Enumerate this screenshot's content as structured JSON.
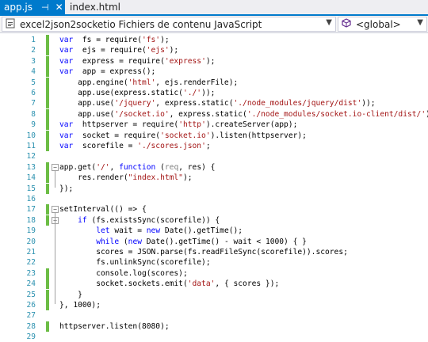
{
  "tabs": [
    {
      "label": "app.js",
      "active": true,
      "pin": "⊣",
      "close": "✕"
    },
    {
      "label": "index.html",
      "active": false
    }
  ],
  "nav": {
    "project_label": "excel2json2socketio Fichiers de contenu JavaScript",
    "scope_label": "<global>"
  },
  "colors": {
    "accent": "#007acc",
    "line_numbers": "#2b91af",
    "change_bar": "#6cbd45",
    "keyword": "#0000ff",
    "string": "#a31515"
  },
  "lines": [
    {
      "n": "1",
      "changed": true,
      "code": [
        [
          "kw",
          "var"
        ],
        [
          "",
          "  fs = require("
        ],
        [
          "str",
          "'fs'"
        ],
        [
          "",
          ");"
        ]
      ]
    },
    {
      "n": "2",
      "changed": true,
      "code": [
        [
          "kw",
          "var"
        ],
        [
          "",
          "  ejs = require("
        ],
        [
          "str",
          "'ejs'"
        ],
        [
          "",
          ");"
        ]
      ]
    },
    {
      "n": "3",
      "changed": true,
      "code": [
        [
          "kw",
          "var"
        ],
        [
          "",
          "  express = require("
        ],
        [
          "str",
          "'express'"
        ],
        [
          "",
          ");"
        ]
      ]
    },
    {
      "n": "4",
      "changed": true,
      "code": [
        [
          "kw",
          "var"
        ],
        [
          "",
          "  app = express();"
        ]
      ]
    },
    {
      "n": "5",
      "changed": true,
      "code": [
        [
          "",
          "    app.engine("
        ],
        [
          "str",
          "'html'"
        ],
        [
          "",
          ", ejs.renderFile);"
        ]
      ]
    },
    {
      "n": "6",
      "changed": true,
      "code": [
        [
          "",
          "    app.use(express.static("
        ],
        [
          "str",
          "'./'"
        ],
        [
          "",
          "));"
        ]
      ]
    },
    {
      "n": "7",
      "changed": true,
      "code": [
        [
          "",
          "    app.use("
        ],
        [
          "str",
          "'/jquery'"
        ],
        [
          "",
          ", express.static("
        ],
        [
          "str",
          "'./node_modules/jquery/dist'"
        ],
        [
          "",
          "));"
        ]
      ]
    },
    {
      "n": "8",
      "changed": true,
      "code": [
        [
          "",
          "    app.use("
        ],
        [
          "str",
          "'/socket.io'"
        ],
        [
          "",
          ", express.static("
        ],
        [
          "str",
          "'./node_modules/socket.io-client/dist/'"
        ],
        [
          "",
          "));"
        ]
      ]
    },
    {
      "n": "9",
      "changed": true,
      "code": [
        [
          "kw",
          "var"
        ],
        [
          "",
          "  httpserver = require("
        ],
        [
          "str",
          "'http'"
        ],
        [
          "",
          ").createServer(app);"
        ]
      ]
    },
    {
      "n": "10",
      "changed": true,
      "code": [
        [
          "kw",
          "var"
        ],
        [
          "",
          "  socket = require("
        ],
        [
          "str",
          "'socket.io'"
        ],
        [
          "",
          ").listen(httpserver);"
        ]
      ]
    },
    {
      "n": "11",
      "changed": true,
      "code": [
        [
          "kw",
          "var"
        ],
        [
          "",
          "  scorefile = "
        ],
        [
          "str",
          "'./scores.json'"
        ],
        [
          "",
          ";"
        ]
      ]
    },
    {
      "n": "12",
      "changed": false,
      "code": []
    },
    {
      "n": "13",
      "changed": true,
      "fold": "start",
      "code": [
        [
          "",
          "app.get("
        ],
        [
          "str",
          "'/'"
        ],
        [
          "",
          ", "
        ],
        [
          "kw",
          "function"
        ],
        [
          "",
          " ("
        ],
        [
          "dim",
          "req"
        ],
        [
          "",
          ", res) {"
        ]
      ]
    },
    {
      "n": "14",
      "changed": true,
      "code": [
        [
          "",
          "    res.render("
        ],
        [
          "str",
          "\"index.html\""
        ],
        [
          "",
          ");"
        ]
      ]
    },
    {
      "n": "15",
      "changed": true,
      "code": [
        [
          "",
          "});"
        ]
      ]
    },
    {
      "n": "16",
      "changed": false,
      "code": []
    },
    {
      "n": "17",
      "changed": true,
      "fold": "start",
      "code": [
        [
          "",
          "setInterval(() => {"
        ]
      ]
    },
    {
      "n": "18",
      "changed": true,
      "fold": "start",
      "code": [
        [
          "",
          "    "
        ],
        [
          "kw",
          "if"
        ],
        [
          "",
          " (fs.existsSync(scorefile)) {"
        ]
      ]
    },
    {
      "n": "19",
      "changed": false,
      "code": [
        [
          "",
          "        "
        ],
        [
          "kw",
          "let"
        ],
        [
          "",
          " wait = "
        ],
        [
          "kw",
          "new"
        ],
        [
          "",
          " Date().getTime();"
        ]
      ]
    },
    {
      "n": "20",
      "changed": false,
      "code": [
        [
          "",
          "        "
        ],
        [
          "kw",
          "while"
        ],
        [
          "",
          " ("
        ],
        [
          "kw",
          "new"
        ],
        [
          "",
          " Date().getTime() - wait < 1000) { }"
        ]
      ]
    },
    {
      "n": "21",
      "changed": false,
      "code": [
        [
          "",
          "        scores = JSON.parse(fs.readFileSync(scorefile)).scores;"
        ]
      ]
    },
    {
      "n": "22",
      "changed": false,
      "code": [
        [
          "",
          "        fs.unlinkSync(scorefile);"
        ]
      ]
    },
    {
      "n": "23",
      "changed": true,
      "code": [
        [
          "",
          "        console.log(scores);"
        ]
      ]
    },
    {
      "n": "24",
      "changed": true,
      "code": [
        [
          "",
          "        socket.sockets.emit("
        ],
        [
          "str",
          "'data'"
        ],
        [
          "",
          ", { scores });"
        ]
      ]
    },
    {
      "n": "25",
      "changed": true,
      "code": [
        [
          "",
          "    }"
        ]
      ]
    },
    {
      "n": "26",
      "changed": true,
      "code": [
        [
          "",
          "}, 1000);"
        ]
      ]
    },
    {
      "n": "27",
      "changed": false,
      "code": []
    },
    {
      "n": "28",
      "changed": true,
      "code": [
        [
          "",
          "httpserver.listen(8080);"
        ]
      ]
    },
    {
      "n": "29",
      "changed": false,
      "code": []
    }
  ]
}
